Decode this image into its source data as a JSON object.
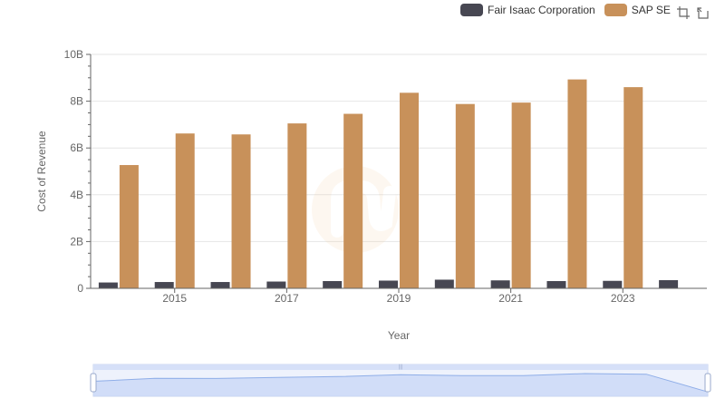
{
  "legend": {
    "items": [
      {
        "label": "Fair Isaac Corporation",
        "color": "#474752"
      },
      {
        "label": "SAP SE",
        "color": "#c8915a"
      }
    ]
  },
  "toolbox": {
    "icons": [
      "zoom-icon",
      "restore-icon"
    ]
  },
  "chart_data": {
    "type": "bar",
    "x": [
      2014,
      2015,
      2016,
      2017,
      2018,
      2019,
      2020,
      2021,
      2022,
      2023,
      2024
    ],
    "x_tick_labels": [
      "2015",
      "2017",
      "2019",
      "2021",
      "2023"
    ],
    "series": [
      {
        "name": "Fair Isaac Corporation",
        "color": "#474752",
        "values": [
          0.25,
          0.27,
          0.27,
          0.29,
          0.31,
          0.33,
          0.37,
          0.34,
          0.31,
          0.32,
          0.35
        ]
      },
      {
        "name": "SAP SE",
        "color": "#c8915a",
        "values": [
          5.27,
          6.62,
          6.58,
          7.05,
          7.46,
          8.36,
          7.88,
          7.94,
          8.93,
          8.6,
          null
        ]
      }
    ],
    "xlabel": "Year",
    "ylabel": "Cost of Revenue",
    "ylim": [
      0,
      10
    ],
    "y_ticks": [
      0,
      2,
      4,
      6,
      8,
      10
    ],
    "y_tick_labels": [
      "0",
      "2B",
      "4B",
      "6B",
      "8B",
      "10B"
    ],
    "grid": true
  }
}
